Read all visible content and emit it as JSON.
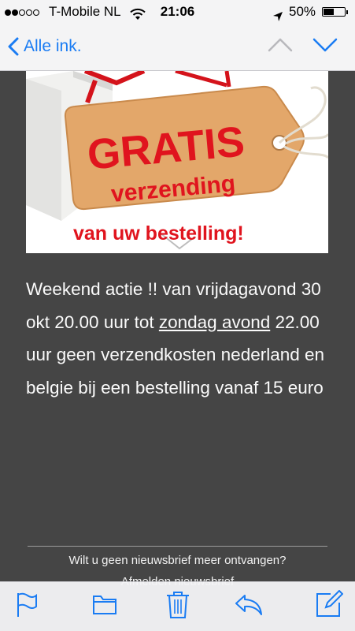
{
  "status_bar": {
    "carrier": "T-Mobile NL",
    "time": "21:06",
    "battery": "50%",
    "battery_level": 0.5
  },
  "nav": {
    "back_label": "Alle ink."
  },
  "promo": {
    "line1": "GRATIS",
    "line2": "verzending",
    "line3": "van uw bestelling!"
  },
  "message": {
    "text_before_link": "Weekend actie !! van vrijdagavond 30 okt 20.00 uur tot ",
    "link_text": "zondag avond",
    "text_after_link": " 22.00 uur geen verzendkosten nederland en belgie bij een bestelling vanaf 15 euro"
  },
  "footer": {
    "unsubscribe_question": "Wilt u geen nieuwsbrief meer ontvangen?",
    "unsubscribe_link": "Afmelden nieuwsbrief"
  },
  "colors": {
    "accent": "#1a7cf3",
    "background": "#454545",
    "promo_red": "#e0141e"
  }
}
